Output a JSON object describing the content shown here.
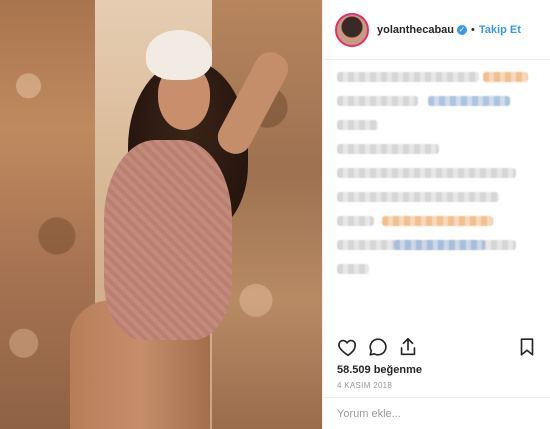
{
  "post": {
    "photo_alt": "",
    "header": {
      "username": "yolanthecabau",
      "separator": "•",
      "follow_label": "Takip Et"
    },
    "likes_text": "58.509 beğenme",
    "date_text": "4 KASIM 2018",
    "comment_placeholder": "Yorum ekle..."
  },
  "icons": {
    "like": "heart-icon",
    "comment": "comment-bubble-icon",
    "share": "share-icon",
    "save": "bookmark-icon",
    "verified": "verified-badge-icon"
  },
  "colors": {
    "accent_blue": "#3897f0",
    "text": "#262626",
    "muted": "#999999",
    "border": "#efefef"
  }
}
